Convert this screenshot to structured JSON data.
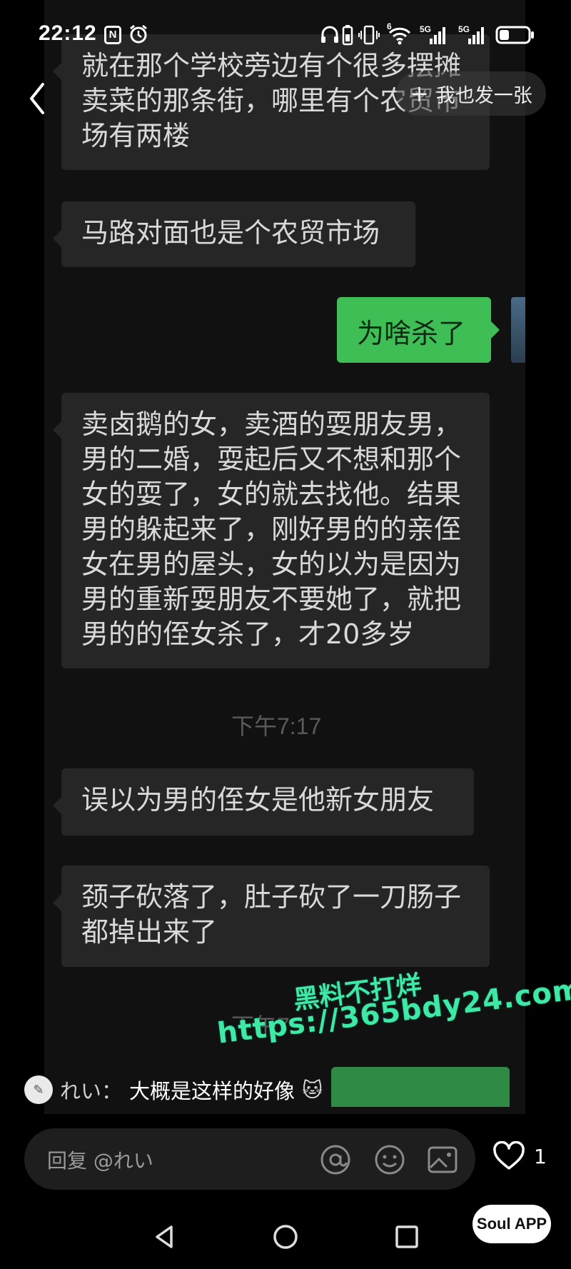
{
  "status_bar": {
    "time": "22:12",
    "network_1": "5G",
    "network_2": "5G",
    "wifi_6": "6"
  },
  "header": {
    "post_button_label": "我也发一张",
    "post_button_plus": "+"
  },
  "chat": {
    "messages": [
      {
        "side": "left",
        "text": "就在那个学校旁边有个很多摆摊卖菜的那条街，哪里有个农贸市场有两楼"
      },
      {
        "side": "left",
        "text": "马路对面也是个农贸市场"
      },
      {
        "side": "right",
        "text": "为啥杀了"
      },
      {
        "side": "left",
        "text": "卖卤鹅的女，卖酒的耍朋友男，男的二婚，耍起后又不想和那个女的耍了，女的就去找他。结果男的躲起来了，刚好男的的亲侄女在男的屋头，女的以为是因为男的重新耍朋友不要她了，就把男的的侄女杀了，才20多岁"
      },
      {
        "side": "left",
        "text": "误以为男的侄女是他新女朋友"
      },
      {
        "side": "left",
        "text": "颈子砍落了，肚子砍了一刀肠子都掉出来了"
      }
    ],
    "timestamp_1": "下午7:17",
    "timestamp_2": "下午7"
  },
  "watermark": {
    "line1": "黑料不打烊",
    "line2": "https://365bdy24.com"
  },
  "comment": {
    "user": "れい：",
    "text": "大概是这样的好像"
  },
  "reply_bar": {
    "placeholder": "回复 @れい"
  },
  "like": {
    "count": "1"
  },
  "branding": {
    "soul_label": "Soul APP"
  }
}
